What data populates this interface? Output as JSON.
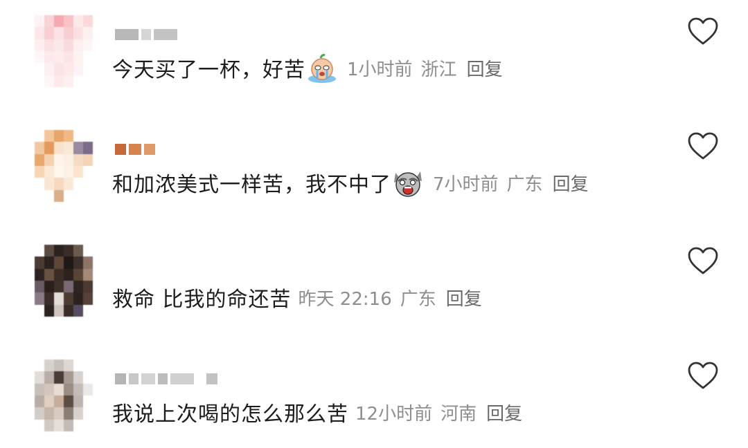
{
  "comments": [
    {
      "text": "今天买了一杯，好苦",
      "emoji": "crying-face-emoji",
      "time": "1小时前",
      "location": "浙江",
      "reply_label": "回复"
    },
    {
      "text": "和加浓美式一样苦，我不中了",
      "emoji": "screaming-cat-emoji",
      "time": "7小时前",
      "location": "广东",
      "reply_label": "回复"
    },
    {
      "text": "救命 比我的命还苦",
      "time": "昨天 22:16",
      "location": "广东",
      "reply_label": "回复"
    },
    {
      "text": "我说上次喝的怎么那么苦",
      "time": "12小时前",
      "location": "河南",
      "reply_label": "回复"
    }
  ],
  "icons": {
    "like": "heart-outline-icon"
  },
  "colors": {
    "primary_text": "#1c1c1c",
    "meta_text": "#8e8e8e",
    "reply_text": "#6a6a6a",
    "heart_stroke": "#333333"
  }
}
